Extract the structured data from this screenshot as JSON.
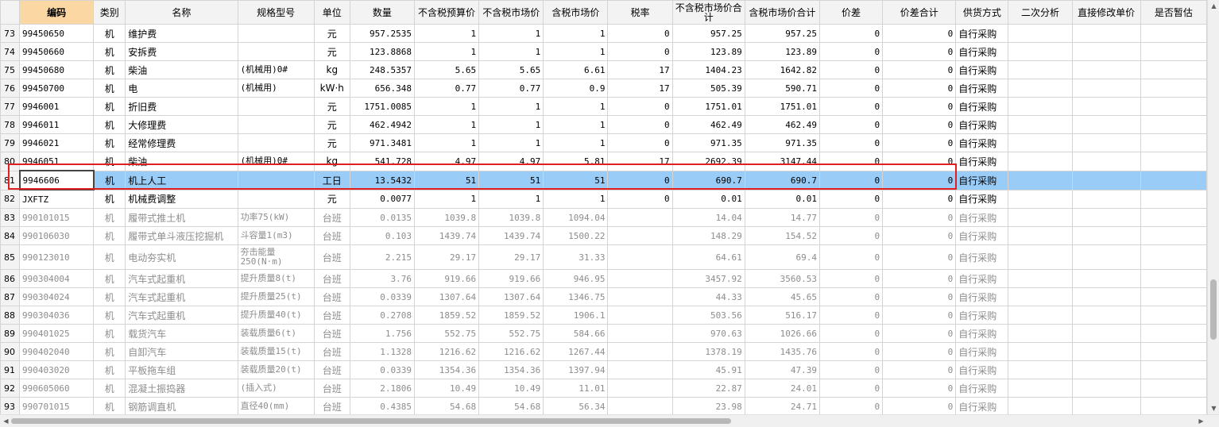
{
  "columns": [
    "",
    "编码",
    "类别",
    "名称",
    "规格型号",
    "单位",
    "数量",
    "不含税预算价",
    "不含税市场价",
    "含税市场价",
    "税率",
    "不含税市场价合计",
    "含税市场价合计",
    "价差",
    "价差合计",
    "供货方式",
    "二次分析",
    "直接修改单价",
    "是否暂估"
  ],
  "highlighted_column": "编码",
  "rows": [
    {
      "no": "73",
      "code": "99450650",
      "cat": "机",
      "name": "维护费",
      "spec": "",
      "unit": "元",
      "qty": "957.2535",
      "budget": "1",
      "market": "1",
      "market_tax": "1",
      "tax": "0",
      "sum": "957.25",
      "sum_tax": "957.25",
      "diff": "0",
      "diff_sum": "0",
      "supply": "自行采购",
      "state": "normal"
    },
    {
      "no": "74",
      "code": "99450660",
      "cat": "机",
      "name": "安拆费",
      "spec": "",
      "unit": "元",
      "qty": "123.8868",
      "budget": "1",
      "market": "1",
      "market_tax": "1",
      "tax": "0",
      "sum": "123.89",
      "sum_tax": "123.89",
      "diff": "0",
      "diff_sum": "0",
      "supply": "自行采购",
      "state": "normal"
    },
    {
      "no": "75",
      "code": "99450680",
      "cat": "机",
      "name": "柴油",
      "spec": "(机械用)0#",
      "unit": "kg",
      "qty": "248.5357",
      "budget": "5.65",
      "market": "5.65",
      "market_tax": "6.61",
      "tax": "17",
      "sum": "1404.23",
      "sum_tax": "1642.82",
      "diff": "0",
      "diff_sum": "0",
      "supply": "自行采购",
      "state": "normal"
    },
    {
      "no": "76",
      "code": "99450700",
      "cat": "机",
      "name": "电",
      "spec": "(机械用)",
      "unit": "kW·h",
      "qty": "656.348",
      "budget": "0.77",
      "market": "0.77",
      "market_tax": "0.9",
      "tax": "17",
      "sum": "505.39",
      "sum_tax": "590.71",
      "diff": "0",
      "diff_sum": "0",
      "supply": "自行采购",
      "state": "normal"
    },
    {
      "no": "77",
      "code": "9946001",
      "cat": "机",
      "name": "折旧费",
      "spec": "",
      "unit": "元",
      "qty": "1751.0085",
      "budget": "1",
      "market": "1",
      "market_tax": "1",
      "tax": "0",
      "sum": "1751.01",
      "sum_tax": "1751.01",
      "diff": "0",
      "diff_sum": "0",
      "supply": "自行采购",
      "state": "normal"
    },
    {
      "no": "78",
      "code": "9946011",
      "cat": "机",
      "name": "大修理费",
      "spec": "",
      "unit": "元",
      "qty": "462.4942",
      "budget": "1",
      "market": "1",
      "market_tax": "1",
      "tax": "0",
      "sum": "462.49",
      "sum_tax": "462.49",
      "diff": "0",
      "diff_sum": "0",
      "supply": "自行采购",
      "state": "normal"
    },
    {
      "no": "79",
      "code": "9946021",
      "cat": "机",
      "name": "经常修理费",
      "spec": "",
      "unit": "元",
      "qty": "971.3481",
      "budget": "1",
      "market": "1",
      "market_tax": "1",
      "tax": "0",
      "sum": "971.35",
      "sum_tax": "971.35",
      "diff": "0",
      "diff_sum": "0",
      "supply": "自行采购",
      "state": "normal"
    },
    {
      "no": "80",
      "code": "9946051",
      "cat": "机",
      "name": "柴油",
      "spec": "(机械用)0#",
      "unit": "kg",
      "qty": "541.728",
      "budget": "4.97",
      "market": "4.97",
      "market_tax": "5.81",
      "tax": "17",
      "sum": "2692.39",
      "sum_tax": "3147.44",
      "diff": "0",
      "diff_sum": "0",
      "supply": "自行采购",
      "state": "normal"
    },
    {
      "no": "81",
      "code": "9946606",
      "cat": "机",
      "name": "机上人工",
      "spec": "",
      "unit": "工日",
      "qty": "13.5432",
      "budget": "51",
      "market": "51",
      "market_tax": "51",
      "tax": "0",
      "sum": "690.7",
      "sum_tax": "690.7",
      "diff": "0",
      "diff_sum": "0",
      "supply": "自行采购",
      "state": "selected"
    },
    {
      "no": "82",
      "code": "JXFTZ",
      "cat": "机",
      "name": "机械费调整",
      "spec": "",
      "unit": "元",
      "qty": "0.0077",
      "budget": "1",
      "market": "1",
      "market_tax": "1",
      "tax": "0",
      "sum": "0.01",
      "sum_tax": "0.01",
      "diff": "0",
      "diff_sum": "0",
      "supply": "自行采购",
      "state": "normal"
    },
    {
      "no": "83",
      "code": "990101015",
      "cat": "机",
      "name": "履带式推土机",
      "spec": "功率75(kW)",
      "unit": "台班",
      "qty": "0.0135",
      "budget": "1039.8",
      "market": "1039.8",
      "market_tax": "1094.04",
      "tax": "",
      "sum": "14.04",
      "sum_tax": "14.77",
      "diff": "0",
      "diff_sum": "0",
      "supply": "自行采购",
      "state": "dim"
    },
    {
      "no": "84",
      "code": "990106030",
      "cat": "机",
      "name": "履带式单斗液压挖掘机",
      "spec": "斗容量1(m3)",
      "unit": "台班",
      "qty": "0.103",
      "budget": "1439.74",
      "market": "1439.74",
      "market_tax": "1500.22",
      "tax": "",
      "sum": "148.29",
      "sum_tax": "154.52",
      "diff": "0",
      "diff_sum": "0",
      "supply": "自行采购",
      "state": "dim"
    },
    {
      "no": "85",
      "code": "990123010",
      "cat": "机",
      "name": "电动夯实机",
      "spec": "夯击能量250(N·m)",
      "unit": "台班",
      "qty": "2.215",
      "budget": "29.17",
      "market": "29.17",
      "market_tax": "31.33",
      "tax": "",
      "sum": "64.61",
      "sum_tax": "69.4",
      "diff": "0",
      "diff_sum": "0",
      "supply": "自行采购",
      "state": "dim",
      "tall": true
    },
    {
      "no": "86",
      "code": "990304004",
      "cat": "机",
      "name": "汽车式起重机",
      "spec": "提升质量8(t)",
      "unit": "台班",
      "qty": "3.76",
      "budget": "919.66",
      "market": "919.66",
      "market_tax": "946.95",
      "tax": "",
      "sum": "3457.92",
      "sum_tax": "3560.53",
      "diff": "0",
      "diff_sum": "0",
      "supply": "自行采购",
      "state": "dim"
    },
    {
      "no": "87",
      "code": "990304024",
      "cat": "机",
      "name": "汽车式起重机",
      "spec": "提升质量25(t)",
      "unit": "台班",
      "qty": "0.0339",
      "budget": "1307.64",
      "market": "1307.64",
      "market_tax": "1346.75",
      "tax": "",
      "sum": "44.33",
      "sum_tax": "45.65",
      "diff": "0",
      "diff_sum": "0",
      "supply": "自行采购",
      "state": "dim"
    },
    {
      "no": "88",
      "code": "990304036",
      "cat": "机",
      "name": "汽车式起重机",
      "spec": "提升质量40(t)",
      "unit": "台班",
      "qty": "0.2708",
      "budget": "1859.52",
      "market": "1859.52",
      "market_tax": "1906.1",
      "tax": "",
      "sum": "503.56",
      "sum_tax": "516.17",
      "diff": "0",
      "diff_sum": "0",
      "supply": "自行采购",
      "state": "dim"
    },
    {
      "no": "89",
      "code": "990401025",
      "cat": "机",
      "name": "载货汽车",
      "spec": "装载质量6(t)",
      "unit": "台班",
      "qty": "1.756",
      "budget": "552.75",
      "market": "552.75",
      "market_tax": "584.66",
      "tax": "",
      "sum": "970.63",
      "sum_tax": "1026.66",
      "diff": "0",
      "diff_sum": "0",
      "supply": "自行采购",
      "state": "dim"
    },
    {
      "no": "90",
      "code": "990402040",
      "cat": "机",
      "name": "自卸汽车",
      "spec": "装载质量15(t)",
      "unit": "台班",
      "qty": "1.1328",
      "budget": "1216.62",
      "market": "1216.62",
      "market_tax": "1267.44",
      "tax": "",
      "sum": "1378.19",
      "sum_tax": "1435.76",
      "diff": "0",
      "diff_sum": "0",
      "supply": "自行采购",
      "state": "dim"
    },
    {
      "no": "91",
      "code": "990403020",
      "cat": "机",
      "name": "平板拖车组",
      "spec": "装载质量20(t)",
      "unit": "台班",
      "qty": "0.0339",
      "budget": "1354.36",
      "market": "1354.36",
      "market_tax": "1397.94",
      "tax": "",
      "sum": "45.91",
      "sum_tax": "47.39",
      "diff": "0",
      "diff_sum": "0",
      "supply": "自行采购",
      "state": "dim"
    },
    {
      "no": "92",
      "code": "990605060",
      "cat": "机",
      "name": "混凝土振捣器",
      "spec": "(插入式)",
      "unit": "台班",
      "qty": "2.1806",
      "budget": "10.49",
      "market": "10.49",
      "market_tax": "11.01",
      "tax": "",
      "sum": "22.87",
      "sum_tax": "24.01",
      "diff": "0",
      "diff_sum": "0",
      "supply": "自行采购",
      "state": "dim"
    },
    {
      "no": "93",
      "code": "990701015",
      "cat": "机",
      "name": "钢筋调直机",
      "spec": "直径40(mm)",
      "unit": "台班",
      "qty": "0.4385",
      "budget": "54.68",
      "market": "54.68",
      "market_tax": "56.34",
      "tax": "",
      "sum": "23.98",
      "sum_tax": "24.71",
      "diff": "0",
      "diff_sum": "0",
      "supply": "自行采购",
      "state": "dim"
    }
  ],
  "scrollbars": {
    "up_arrow": "▲",
    "down_arrow": "▼",
    "left_arrow": "◀",
    "right_arrow": "▶"
  }
}
